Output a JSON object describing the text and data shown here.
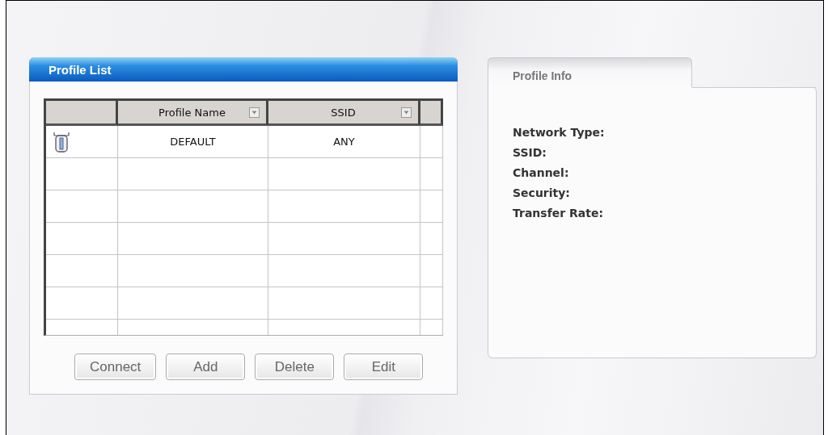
{
  "profile_list": {
    "title": "Profile List",
    "columns": [
      "Profile Name",
      "SSID"
    ],
    "rows": [
      {
        "profile_name": "DEFAULT",
        "ssid": "ANY"
      }
    ],
    "buttons": [
      "Connect",
      "Add",
      "Delete",
      "Edit"
    ]
  },
  "profile_info": {
    "tab": "Profile Info",
    "fields": [
      "Network Type:",
      "SSID:",
      "Channel:",
      "Security:",
      "Transfer Rate:"
    ]
  }
}
